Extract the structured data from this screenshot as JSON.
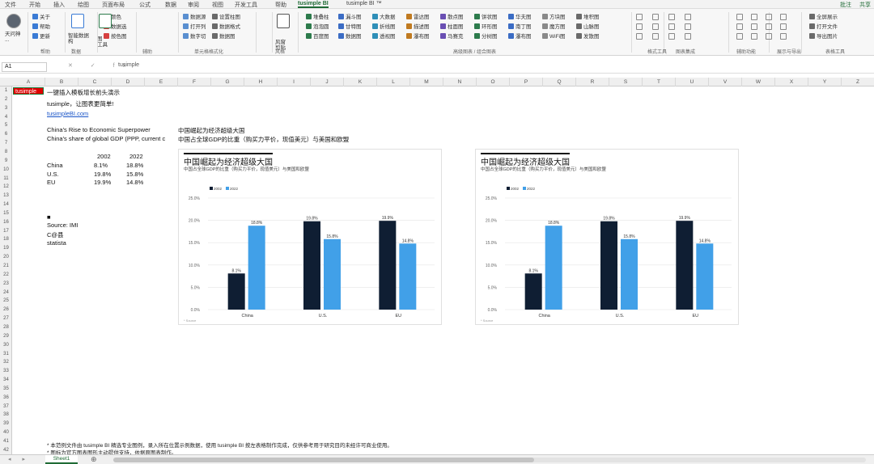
{
  "tabs": [
    "文件",
    "开始",
    "插入",
    "绘图",
    "页面布局",
    "公式",
    "数据",
    "审阅",
    "视图",
    "开发工具",
    "帮助",
    "tusimple BI",
    "tusimple BI ™"
  ],
  "active_tab": "tusimple BI",
  "share": {
    "comment": "批注",
    "share": "共享"
  },
  "ribbon": {
    "user": "天问神\n...",
    "btns_col1": [
      "关于",
      "帮助",
      "更新"
    ],
    "btn_conditional": "智能数据\n构",
    "btn_chart": "图\n工具",
    "btns_color": [
      "颜色",
      "数据选",
      "按色图"
    ],
    "btns_data": [
      "数据源",
      "打开列",
      "数字切"
    ],
    "btns_data2": [
      "设置柱图",
      "数据格式",
      "数据图"
    ],
    "btn_copy": "风窗\n剪贴",
    "btns_chart1": [
      "堆叠柱",
      "泡泡圆",
      "百度图"
    ],
    "btns_chart2": [
      "漏斗图",
      "甘特图",
      "数据图"
    ],
    "btns_chart3": [
      "大数据",
      "折线图",
      "透视图"
    ],
    "btns_chart4": [
      "雷达图",
      "描述图",
      "瀑布图"
    ],
    "btns_chart5": [
      "散点图",
      "柱面图",
      "马赛克"
    ],
    "btns_chart6": [
      "饼状图",
      "环形图",
      "分树图"
    ],
    "btns_chart7": [
      "华夫图",
      "南丁图",
      "瀑布图"
    ],
    "btns_chart8": [
      "方块图",
      "魔方图",
      "WiFi图"
    ],
    "btns_chart9": [
      "堆积图",
      "山脉图",
      "发散图"
    ],
    "btns_right1": [
      "全屏展示",
      "打开文件",
      "导出图片"
    ],
    "group_labels": [
      "帮助",
      "数据",
      "表格工具",
      "图表工具",
      "辅助",
      "单元格格式化",
      "风格",
      "高级图表 / 组合图表",
      "格式工具",
      "图表集成",
      "辅助功能",
      "展示与导出"
    ]
  },
  "formula_bar": {
    "namebox": "A1",
    "fx": "fx",
    "value": "tusimple"
  },
  "columns": [
    "A",
    "B",
    "C",
    "D",
    "E",
    "F",
    "G",
    "H",
    "I",
    "J",
    "K",
    "L",
    "M",
    "N",
    "O",
    "P",
    "Q",
    "R",
    "S",
    "T",
    "U",
    "V",
    "W",
    "X",
    "Y",
    "Z"
  ],
  "rows": [
    "1",
    "2",
    "3",
    "4",
    "5",
    "6",
    "7",
    "8",
    "9",
    "10",
    "11",
    "12",
    "13",
    "14",
    "15",
    "16",
    "17",
    "18",
    "19",
    "20",
    "21",
    "22",
    "23",
    "24",
    "25",
    "26",
    "27",
    "28",
    "29",
    "30",
    "31",
    "32",
    "33",
    "34",
    "35",
    "36",
    "37",
    "38",
    "39",
    "40",
    "41",
    "42"
  ],
  "cells": {
    "a1": "tusimple",
    "b1": "一键插入模板增长前头演示",
    "b2": "tusimple，让图表更简单!",
    "b3": "tusimpleBI.com",
    "b5": "China's Rise to Economic Superpower",
    "f5": "中国崛起为经济超级大国",
    "b6": "China's share of global GDP (PPP, current c",
    "f6": "中国占全球GDP的比重（购买力平价，现值美元）与美国和欧盟",
    "hdr_2002": "2002",
    "hdr_2022": "2022",
    "table": [
      {
        "name": "China",
        "v2002": "8.1%",
        "v2022": "18.8%"
      },
      {
        "name": "U.S.",
        "v2002": "19.8%",
        "v2022": "15.8%"
      },
      {
        "name": "EU",
        "v2002": "19.9%",
        "v2022": "14.8%"
      }
    ],
    "b15": "■",
    "b16": "Source: IMI",
    "b17": "C@县",
    "b18": "statista"
  },
  "chart_data": [
    {
      "type": "bar",
      "title": "中国崛起为经济超级大国",
      "subtitle": "中国占全球GDP的比重（购买力平价，现值美元）与美国和欧盟",
      "categories": [
        "China",
        "U.S.",
        "EU"
      ],
      "series": [
        {
          "name": "2002",
          "values": [
            8.1,
            19.8,
            19.9
          ]
        },
        {
          "name": "2022",
          "values": [
            18.8,
            15.8,
            14.8
          ]
        }
      ],
      "ylim": [
        0,
        25
      ],
      "yticks": [
        "0.0%",
        "5.0%",
        "10.0%",
        "15.0%",
        "20.0%",
        "25.0%"
      ],
      "data_labels": [
        [
          "8.1%",
          "19.8%",
          "19.9%"
        ],
        [
          "18.8%",
          "15.8%",
          "14.8%"
        ]
      ],
      "legend": "top-left",
      "grid": true,
      "colors": [
        "#0f1e33",
        "#41a0e8"
      ],
      "footer": "* Source"
    },
    {
      "type": "bar",
      "title": "中国崛起为经济超级大国",
      "subtitle": "中国占全球GDP的比重（购买力平价，现值美元）与美国和欧盟",
      "categories": [
        "China",
        "U.S.",
        "EU"
      ],
      "series": [
        {
          "name": "2002",
          "values": [
            8.1,
            19.8,
            19.9
          ]
        },
        {
          "name": "2022",
          "values": [
            18.8,
            15.8,
            14.8
          ]
        }
      ],
      "ylim": [
        0,
        25
      ],
      "yticks": [
        "0.0%",
        "5.0%",
        "10.0%",
        "15.0%",
        "20.0%",
        "25.0%"
      ],
      "data_labels": [
        [
          "8.1%",
          "19.8%",
          "19.9%"
        ],
        [
          "18.8%",
          "15.8%",
          "14.8%"
        ]
      ],
      "legend": "top-left",
      "grid": true,
      "colors": [
        "#0f1e33",
        "#41a0e8"
      ],
      "footer": "* Source"
    }
  ],
  "notes": [
    "* 本范例文件由 tusimple BI 精选专业图例，录入所在位置示例数据，使用 tusimple BI 按左表格制作完成，仅供参考用于研究目的未经许可商业使用。",
    "* 图标为官方图表图形主动提供支持，依据原图表制作。"
  ],
  "sheet_tab": "Sheet1",
  "add_sheet": "⊕"
}
